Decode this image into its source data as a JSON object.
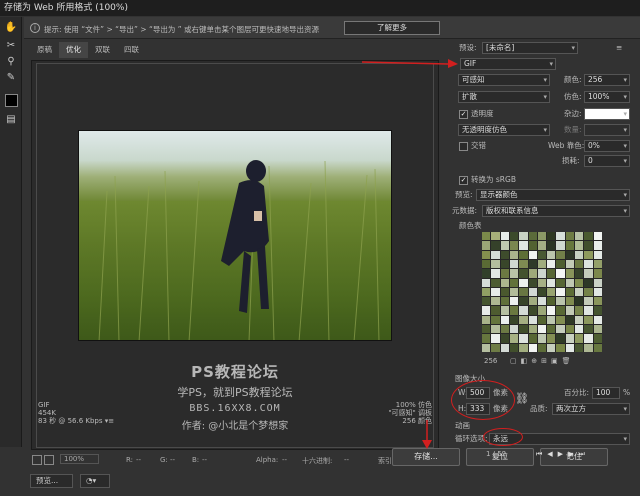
{
  "window": {
    "title": "存储为 Web 所用格式 (100%)"
  },
  "hint": {
    "text": "提示:  使用 “文件” > “导出” > “导出为   ” 或右键单击某个图层可更快速地导出资源",
    "learn_more": "了解更多"
  },
  "tabs": [
    "原稿",
    "优化",
    "双联",
    "四联"
  ],
  "preview_info": {
    "left_lines": [
      "GIF",
      "454K",
      "83 秒 @ 56.6 Kbps"
    ],
    "left_menu": "▾≡",
    "right_lines": [
      "100% 仿色",
      "\"可感知\" 调板",
      "256 颜色"
    ]
  },
  "watermark": {
    "line1": "PS教程论坛",
    "line2": "学PS，就到PS教程论坛",
    "line3": "BBS.16XX8.COM",
    "line4": "作者: @小北是个梦想家"
  },
  "statusbar": {
    "zoom": "100%",
    "r_label": "R:",
    "r_value": "--",
    "g_label": "G:",
    "g_value": "--",
    "b_label": "B:",
    "b_value": "--",
    "alpha_label": "Alpha:",
    "alpha_value": "--",
    "hex_label": "十六进制:",
    "hex_value": "--",
    "index_label": "索引:",
    "index_value": "--"
  },
  "bottom": {
    "preview_label": "预览...",
    "save": "存储...",
    "reset": "复位",
    "remember": "记住"
  },
  "panel": {
    "preset_label": "预设:",
    "preset_value": "[未命名]",
    "format": "GIF",
    "reduction": "可感知",
    "colors_label": "颜色:",
    "colors_value": "256",
    "dither_algo": "扩散",
    "dither_label": "仿色:",
    "dither_value": "100%",
    "transparency_label": "透明度",
    "matte_label": "杂边:",
    "trans_dither": "无透明度仿色",
    "amount_label": "数量:",
    "interlaced_label": "交错",
    "web_snap_label": "Web 靠色:",
    "web_snap_value": "0%",
    "lossy_label": "损耗:",
    "lossy_value": "0",
    "srgb_label": "转换为 sRGB",
    "preview_label": "预览:",
    "preview_value": "显示器颜色",
    "metadata_label": "元数据:",
    "metadata_value": "版权和联系信息",
    "color_table_label": "颜色表",
    "color_count": "256",
    "image_size_label": "图像大小",
    "w_label": "W:",
    "w_value": "500",
    "h_label": "H:",
    "h_value": "333",
    "px_unit": "像素",
    "percent_label": "百分比:",
    "percent_value": "100",
    "percent_unit": "%",
    "quality_label": "品质:",
    "quality_value": "两次立方",
    "animation_label": "动画",
    "loop_label": "循环选项:",
    "loop_value": "永远",
    "frame_counter": "1 / 52"
  },
  "colors": {
    "accent_red": "#d21f1f",
    "background": "#323232"
  },
  "color_table": [
    "#7b8a4a",
    "#a8b07a",
    "#e6ecea",
    "#3b4a2a",
    "#c9d3c4",
    "#5b6b3a",
    "#8c9a66",
    "#2e3822",
    "#d8e0da",
    "#6e7c44",
    "#b7c2a6",
    "#4a5a30",
    "#f2f5f3",
    "#9aa676",
    "#35412a",
    "#c0c8b0",
    "#7a8650",
    "#e0e6e2",
    "#526232",
    "#a3ae84",
    "#2a3424",
    "#cfd8d0",
    "#66763c",
    "#b0bc96",
    "#404e2c",
    "#e9eeeb",
    "#84904e",
    "#d4dcd6",
    "#3e4c2c",
    "#aab48c",
    "#5e6e36",
    "#f0f3f1",
    "#485832",
    "#bcc6ae",
    "#72804a",
    "#2c3626",
    "#c6d0c2",
    "#8e9a5e",
    "#e4eae6",
    "#5a6a34",
    "#b4be9e",
    "#39462a",
    "#d0d8d2",
    "#7e8a52",
    "#2f3a28",
    "#a0ac7e",
    "#eaeeec",
    "#4e5e30",
    "#c2cab6",
    "#6a7842",
    "#dce3de",
    "#94a06a",
    "#31402a",
    "#e2e8e4",
    "#6c7a42",
    "#b9c3a8",
    "#43522e",
    "#9ea97a",
    "#ccd5cd",
    "#576636",
    "#f4f6f5",
    "#88945a",
    "#36432a",
    "#c4ccba",
    "#7c884c",
    "#d6ded8",
    "#4c5c32",
    "#acb68e",
    "#62723a",
    "#ecf0ee",
    "#3c4a2c",
    "#a6b086",
    "#dee5e0",
    "#566634",
    "#bfc8b2",
    "#7e8c4e",
    "#2d3826",
    "#cad2c6",
    "#90a064",
    "#e6ebe8",
    "#4a582e",
    "#b2bc9a",
    "#687642",
    "#d2d9d4",
    "#3a482a",
    "#98a470",
    "#f1f4f2",
    "#5c6c36",
    "#c8d0c0",
    "#748248",
    "#e0e6e3",
    "#465630",
    "#aeb892",
    "#60703a",
    "#eef1ef",
    "#37442a",
    "#a2ad80",
    "#d9e0db",
    "#52622f",
    "#bac4ac",
    "#808c50",
    "#2b3624",
    "#c3cbb8",
    "#8a965c",
    "#e8ece9",
    "#4e5c30",
    "#b6c0a2",
    "#6a7840",
    "#d4dbd6",
    "#3d4b2b",
    "#9ca878",
    "#f3f5f4",
    "#586834",
    "#c1c9b4",
    "#76844a",
    "#dfe5e1",
    "#445430",
    "#a9b38a",
    "#64743c",
    "#ebefed",
    "#38452a",
    "#a4ae82",
    "#dbe2dd",
    "#546432",
    "#bdc7b0",
    "#828e52",
    "#2e3925",
    "#c7cfbe",
    "#8c985e",
    "#e5eae7",
    "#4c5a30",
    "#b3bd9c",
    "#6c7a44",
    "#d1d8d3",
    "#3f4d2b",
    "#9fab7c",
    "#f0f3f2",
    "#5a6a36",
    "#c5cdbc",
    "#788648",
    "#e2e8e5",
    "#475631",
    "#acb690",
    "#66763e",
    "#ecf0ee",
    "#3a472a",
    "#a7b184",
    "#dde3df",
    "#566633",
    "#bec8b2",
    "#848f54",
    "#303b26",
    "#c9d1c2",
    "#8e9a60",
    "#e7ebe8",
    "#4e5e32",
    "#b5bfa0",
    "#6e7c46",
    "#d3dad5",
    "#414f2c",
    "#a1ad7e",
    "#f2f4f3",
    "#5c6c38",
    "#c6cebe",
    "#7a8848",
    "#e3e9e6",
    "#495832",
    "#aeb894",
    "#687840"
  ]
}
